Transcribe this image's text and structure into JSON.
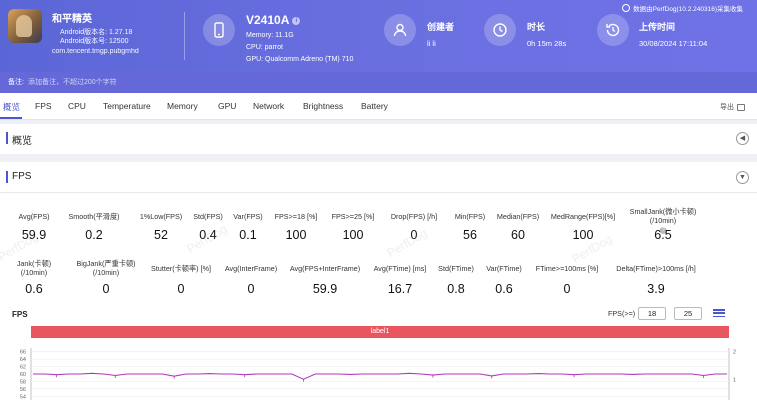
{
  "header": {
    "game_name": "和平精英",
    "android_version_name": "Android版本名: 1.27.18",
    "android_version_code": "Android版本号: 12500",
    "package": "com.tencent.tmgp.pubgmhd",
    "device": {
      "model": "V2410A",
      "info_badge": "i",
      "memory": "Memory: 11.1G",
      "cpu": "CPU: parrot",
      "gpu": "GPU: Qualcomm Adreno (TM) 710"
    },
    "creator": {
      "label": "创建者",
      "value": "li li"
    },
    "duration": {
      "label": "时长",
      "value": "0h 15m 28s"
    },
    "upload": {
      "label": "上传时间",
      "value": "30/08/2024 17:11:04"
    },
    "perfdog": "数据由PerfDog(10.2.240316)采集收集"
  },
  "note": {
    "label": "备注:",
    "hint": "添加备注，不超过200个字符"
  },
  "tabs": [
    "概览",
    "FPS",
    "CPU",
    "Temperature",
    "Memory",
    "GPU",
    "Network",
    "Brightness",
    "Battery"
  ],
  "export_label": "导出",
  "overview_title": "概览",
  "fps_section_title": "FPS",
  "metrics_row1": [
    {
      "label": "Avg(FPS)",
      "value": "59.9"
    },
    {
      "label": "Smooth(平滑度)",
      "value": "0.2"
    },
    {
      "label": "1%Low(FPS)",
      "value": "52"
    },
    {
      "label": "Std(FPS)",
      "value": "0.4"
    },
    {
      "label": "Var(FPS)",
      "value": "0.1"
    },
    {
      "label": "FPS>=18 [%]",
      "value": "100"
    },
    {
      "label": "FPS>=25 [%]",
      "value": "100"
    },
    {
      "label": "Drop(FPS) [/h]",
      "value": "0"
    },
    {
      "label": "Min(FPS)",
      "value": "56"
    },
    {
      "label": "Median(FPS)",
      "value": "60"
    },
    {
      "label": "MedRange(FPS)[%]",
      "value": "100"
    },
    {
      "label": "SmallJank(微小卡顿)",
      "label2": "(/10min)",
      "value": "6.5"
    }
  ],
  "metrics_row2": [
    {
      "label": "Jank(卡顿)",
      "label2": "(/10min)",
      "value": "0.6"
    },
    {
      "label": "BigJank(严重卡顿)",
      "label2": "(/10min)",
      "value": "0"
    },
    {
      "label": "Stutter(卡顿率) [%]",
      "value": "0"
    },
    {
      "label": "Avg(InterFrame)",
      "value": "0"
    },
    {
      "label": "Avg(FPS+InterFrame)",
      "value": "59.9"
    },
    {
      "label": "Avg(FTime) [ms]",
      "value": "16.7"
    },
    {
      "label": "Std(FTime)",
      "value": "0.8"
    },
    {
      "label": "Var(FTime)",
      "value": "0.6"
    },
    {
      "label": "FTime>=100ms [%]",
      "value": "0"
    },
    {
      "label": "Delta(FTime)>100ms [/h]",
      "value": "3.9"
    }
  ],
  "watermark": "PerfDog",
  "fps_chart": {
    "label": "FPS",
    "threshold_label": "FPS(>=)",
    "threshold_1": "18",
    "threshold_2": "25",
    "band_label": "label1"
  },
  "chart_data": {
    "type": "line",
    "title": "FPS",
    "y_ticks": [
      "66",
      "64",
      "62",
      "60",
      "58",
      "56",
      "54"
    ],
    "y_right_ticks": [
      "2",
      "1"
    ],
    "ylim": [
      53,
      67
    ],
    "series": [
      {
        "name": "",
        "color": "#b03ab8",
        "values": [
          60,
          60,
          59.8,
          60,
          60,
          60.2,
          60,
          59.6,
          60,
          60,
          60,
          60,
          59.4,
          60,
          60,
          60.1,
          60,
          60,
          59.8,
          60,
          60,
          60,
          60,
          58.6,
          60,
          60,
          60,
          59.9,
          60,
          60,
          60,
          60,
          60.2,
          60,
          59.7,
          60,
          60,
          60,
          60,
          59.5,
          60,
          60,
          60,
          60.1,
          60,
          60,
          59.8,
          60,
          60,
          60,
          60,
          59.9,
          60,
          60,
          60,
          60,
          60,
          59.6,
          60,
          60
        ]
      },
      {
        "name": "",
        "color": "#3ab8b0",
        "values": [
          0,
          0,
          0,
          0,
          0,
          0,
          0,
          0,
          0,
          0,
          0,
          0,
          0,
          0,
          0,
          0,
          0,
          0,
          0,
          0,
          0,
          0,
          0,
          0,
          0,
          0,
          0,
          0,
          0,
          0,
          0,
          0,
          0,
          0,
          0,
          0,
          0,
          0,
          0,
          0,
          0,
          0,
          0,
          0,
          0,
          0,
          0,
          0,
          0,
          0,
          0,
          0,
          0,
          0,
          0,
          0,
          0,
          0,
          0,
          0
        ]
      }
    ]
  },
  "colors": {
    "accent": "#4a56d0",
    "header": "#5b66d6",
    "band": "#e8565f",
    "fps_line": "#b03ab8"
  }
}
